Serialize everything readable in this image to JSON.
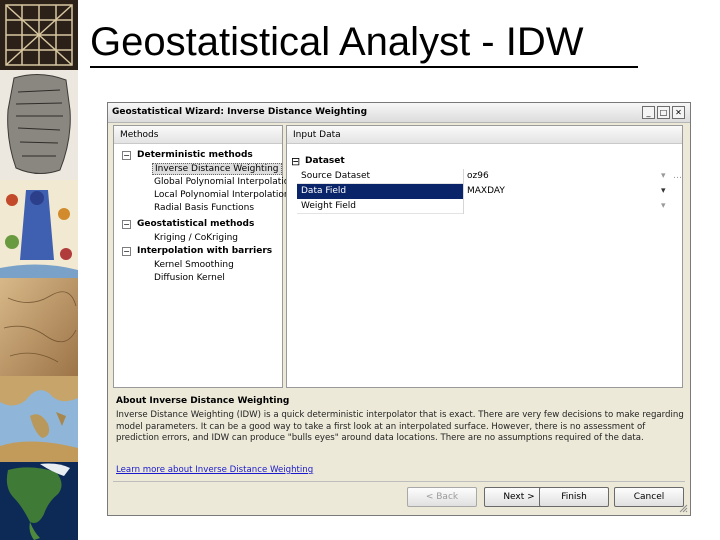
{
  "slide": {
    "title": "Geostatistical Analyst - IDW"
  },
  "images": [
    {
      "name": "map-grid-thumbnail"
    },
    {
      "name": "clay-tablet-thumbnail"
    },
    {
      "name": "illustrated-map-thumbnail"
    },
    {
      "name": "parchment-map-thumbnail"
    },
    {
      "name": "mediterranean-map-thumbnail"
    },
    {
      "name": "north-america-globe-thumbnail"
    }
  ],
  "window": {
    "title": "Geostatistical Wizard: Inverse Distance Weighting",
    "controls": {
      "minimize": "_",
      "maximize": "□",
      "close": "✕"
    }
  },
  "methods": {
    "header": "Methods",
    "groups": [
      {
        "toggle": "−",
        "label": "Deterministic methods",
        "items": [
          "Inverse Distance Weighting",
          "Global Polynomial Interpolation",
          "Local Polynomial Interpolation",
          "Radial Basis Functions"
        ]
      },
      {
        "toggle": "−",
        "label": "Geostatistical methods",
        "items": [
          "Kriging / CoKriging"
        ]
      },
      {
        "toggle": "−",
        "label": "Interpolation with barriers",
        "items": [
          "Kernel Smoothing",
          "Diffusion Kernel"
        ]
      }
    ],
    "selected": "Inverse Distance Weighting"
  },
  "input_data": {
    "header": "Input Data",
    "section_toggle": "⊟",
    "section": "Dataset",
    "rows": [
      {
        "name": "Source Dataset",
        "value": "oz96",
        "dropdown": "▾",
        "more": "…"
      },
      {
        "name": "Data Field",
        "value": "MAXDAY",
        "dropdown": "▾"
      },
      {
        "name": "Weight Field",
        "value": "",
        "dropdown": "▾"
      }
    ]
  },
  "about": {
    "title": "About Inverse Distance Weighting",
    "text": "Inverse Distance Weighting (IDW) is a quick deterministic interpolator that is exact. There are very few decisions to make regarding model parameters. It can be a good way to take a first look at an interpolated surface. However, there is no assessment of prediction errors, and IDW can produce \"bulls eyes\" around data locations. There are no assumptions required of the data.",
    "link": "Learn more about Inverse Distance Weighting"
  },
  "buttons": {
    "back": "< Back",
    "next": "Next >",
    "finish": "Finish",
    "cancel": "Cancel"
  },
  "colors": {
    "selection": "#0a246a",
    "window_bg": "#ece9d8",
    "link": "#1a1acc"
  }
}
